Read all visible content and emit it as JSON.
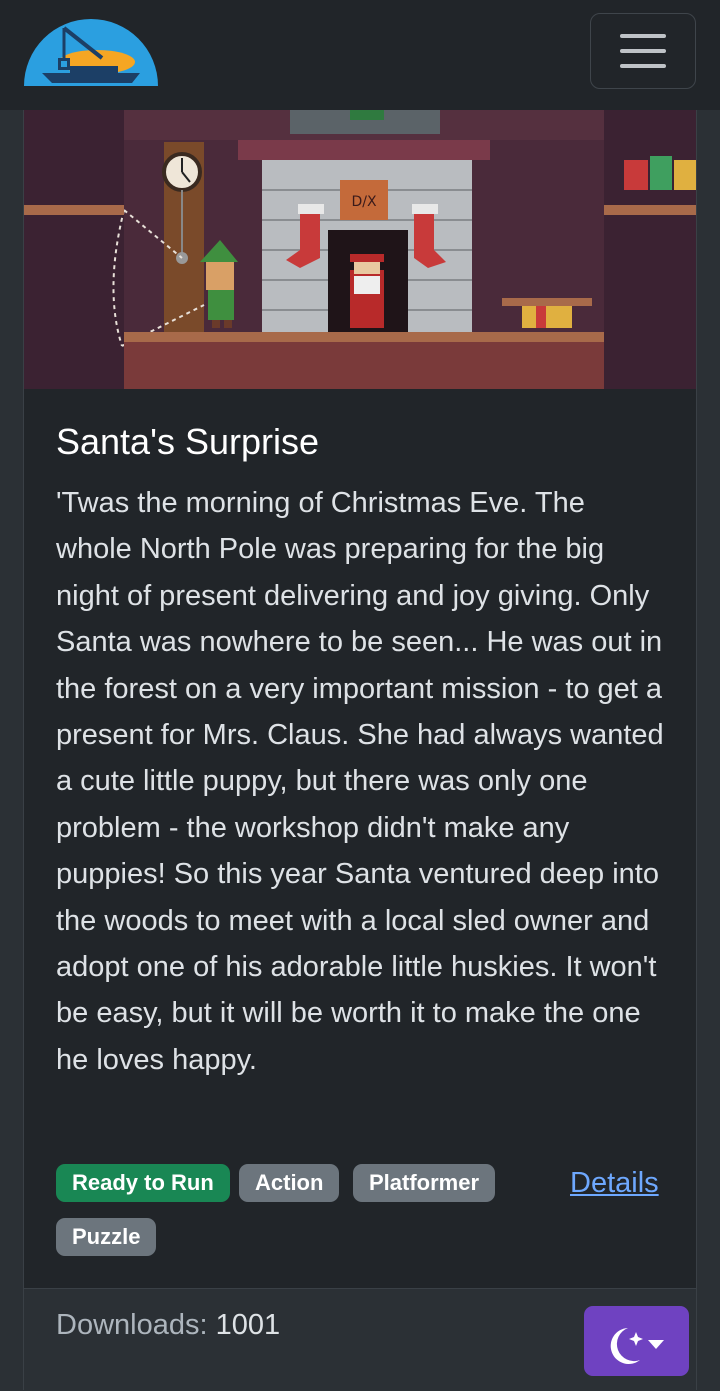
{
  "navbar": {
    "logo_icon": "crane-boat-logo",
    "menu_icon": "hamburger-menu-icon"
  },
  "game": {
    "title": "Santa's Surprise",
    "description": "'Twas the morning of Christmas Eve. The whole North Pole was preparing for the big night of present delivering and joy giving. Only Santa was nowhere to be seen... He was out in the forest on a very important mission - to get a present for Mrs. Claus. She had always wanted a cute little puppy, but there was only one problem - the workshop didn't make any puppies! So this year Santa ventured deep into the woods to meet with a local sled owner and adopt one of his adorable little huskies. It won't be easy, but it will be worth it to make the one he loves happy.",
    "tags": [
      "Ready to Run",
      "Action",
      "Platformer",
      "Puzzle"
    ],
    "details_label": "Details",
    "downloads_label": "Downloads:",
    "downloads_count": "1001"
  },
  "theme_toggle": {
    "icon": "moon-stars-icon",
    "caret_icon": "caret-down-icon"
  },
  "colors": {
    "accent_purple": "#6f42c1",
    "success_green": "#198754",
    "secondary_gray": "#6c757d",
    "link_blue": "#6ea8fe"
  }
}
